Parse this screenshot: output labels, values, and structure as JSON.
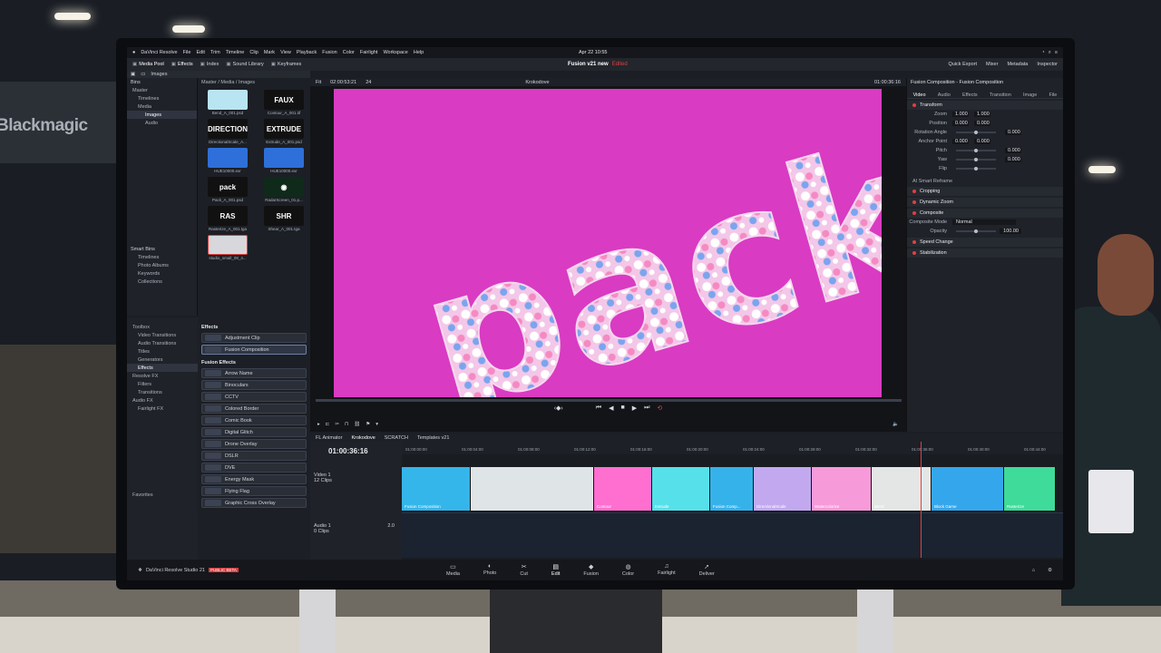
{
  "environment": {
    "booth_sign": "Blackmagic"
  },
  "menubar": {
    "app": "DaVinci Resolve",
    "project_path": "DaVinci Resolve Studio - Fusion v21 new",
    "items": [
      "DaVinci Resolve",
      "File",
      "Edit",
      "Trim",
      "Timeline",
      "Clip",
      "Mark",
      "View",
      "Playback",
      "Fusion",
      "Color",
      "Fairlight",
      "Workspace",
      "Help"
    ],
    "clock": "Apr 22  10:55"
  },
  "toolbar": {
    "left": [
      "Media Pool",
      "Effects",
      "Index",
      "Sound Library",
      "Keyframes"
    ],
    "project_title": "Fusion v21 new",
    "edited": "Edited",
    "right": [
      "Quick Export",
      "Mixer",
      "Metadata",
      "Inspector"
    ]
  },
  "panel_bar": {
    "master_label": "Master / Media / Images",
    "images_label": "Images"
  },
  "bins": {
    "header": "Bins",
    "items": [
      {
        "label": "Master",
        "sel": false
      },
      {
        "label": "Timelines",
        "sel": false
      },
      {
        "label": "Media",
        "sel": false
      },
      {
        "label": "Images",
        "sel": true
      },
      {
        "label": "Audio",
        "sel": false
      }
    ],
    "smart_header": "Smart Bins",
    "smart_items": [
      "Timelines",
      "Photo Albums",
      "Keywords",
      "Collections"
    ]
  },
  "media": {
    "thumbs": [
      {
        "cap": "Bend_A_001.psd",
        "color": "#b9e4f2",
        "txt": ""
      },
      {
        "cap": "Contour_A_001.tif",
        "color": "#111111",
        "txt": "FAUX"
      },
      {
        "cap": "DirectionalScale_A...",
        "color": "#111111",
        "txt": "DIRECTION"
      },
      {
        "cap": "Extrude_A_001.psd",
        "color": "#111111",
        "txt": "EXTRUDE"
      },
      {
        "cap": "HUE10000.exr",
        "color": "#2f6fd9",
        "txt": ""
      },
      {
        "cap": "HUE10000.exr",
        "color": "#2f6fd9",
        "txt": ""
      },
      {
        "cap": "Pack_A_001.psd",
        "color": "#111111",
        "txt": "pack"
      },
      {
        "cap": "RadarScreen_01.p...",
        "color": "#0f2a1a",
        "txt": "◉"
      },
      {
        "cap": "Rasterize_A_001.tga",
        "color": "#111111",
        "txt": "RAS"
      },
      {
        "cap": "Shear_A_001.tga",
        "color": "#111111",
        "txt": "SHR"
      },
      {
        "cap": "studio_small_08_4...",
        "color": "#d8d8dc",
        "txt": ""
      }
    ]
  },
  "effects_tree": {
    "items": [
      "Toolbox",
      "Video Transitions",
      "Audio Transitions",
      "Titles",
      "Generators",
      "Effects",
      "Resolve FX",
      "Filters",
      "Transitions",
      "Audio FX",
      "Fairlight FX"
    ],
    "favorites": "Favorites"
  },
  "effects_list": {
    "group1": "Effects",
    "group1_items": [
      "Adjustment Clip",
      "Fusion Composition"
    ],
    "group2": "Fusion Effects",
    "group2_items": [
      "Arrow Name",
      "Binoculars",
      "CCTV",
      "Colored Border",
      "Comic Book",
      "Digital Glitch",
      "Drone Overlay",
      "DSLR",
      "DVE",
      "Energy Mask",
      "Flying Flag",
      "Graphic Cross Overlay"
    ]
  },
  "viewer": {
    "zoom": "Fit",
    "timecode_left": "02:00:53:21",
    "fps": "24",
    "clip_name": "Krokodove",
    "timecode_right": "01:00:36:16",
    "canvas_color": "#d93bc2",
    "artwork_text": "pack"
  },
  "inspector": {
    "title": "Fusion Composition - Fusion Composition",
    "tabs": [
      "Video",
      "Audio",
      "Effects",
      "Transition",
      "Image",
      "File"
    ],
    "transform": "Transform",
    "rows": [
      {
        "label": "Zoom",
        "x": "1.000",
        "y": "1.000"
      },
      {
        "label": "Position",
        "x": "0.000",
        "y": "0.000"
      },
      {
        "label": "Rotation Angle",
        "x": "",
        "y": "0.000"
      },
      {
        "label": "Anchor Point",
        "x": "0.000",
        "y": "0.000"
      },
      {
        "label": "Pitch",
        "x": "",
        "y": "0.000"
      },
      {
        "label": "Yaw",
        "x": "",
        "y": "0.000"
      },
      {
        "label": "Flip",
        "x": "",
        "y": ""
      }
    ],
    "smart_reframe": "AI Smart Reframe",
    "sections": [
      "Cropping",
      "Dynamic Zoom",
      "Composite"
    ],
    "composite_mode_label": "Composite Mode",
    "composite_mode": "Normal",
    "opacity_label": "Opacity",
    "opacity": "100.00",
    "sections2": [
      "Speed Change",
      "Stabilization"
    ]
  },
  "timeline": {
    "tabs": [
      "FL Animator",
      "Krokodove",
      "SCRATCH",
      "Templates v21"
    ],
    "timecode": "01:00:36:16",
    "ruler": [
      "01:00:00:00",
      "01:00:04:00",
      "01:00:08:00",
      "01:00:12:00",
      "01:00:16:00",
      "01:00:20:00",
      "01:00:24:00",
      "01:00:28:00",
      "01:00:32:00",
      "01:00:36:00",
      "01:00:40:00",
      "01:00:44:00"
    ],
    "video_track": "Video 1",
    "video_clips_count": "12 Clips",
    "audio_track": "Audio 1",
    "audio_clips_count": "0 Clips",
    "audio_level": "2.0",
    "clips": [
      {
        "name": "Fusion Composition",
        "color": "#34b6ea",
        "w": 76
      },
      {
        "name": "",
        "color": "#dfe5e6",
        "w": 136
      },
      {
        "name": "Contour",
        "color": "#ff6fd0",
        "w": 64
      },
      {
        "name": "Extrude",
        "color": "#56e1ea",
        "w": 64
      },
      {
        "name": "Fusion Comp...",
        "color": "#36b2ea",
        "w": 48
      },
      {
        "name": "DirectionalScale",
        "color": "#c2a9ef",
        "w": 64
      },
      {
        "name": "Watercolorize",
        "color": "#f79ad9",
        "w": 66
      },
      {
        "name": "Bend",
        "color": "#e4e6e6",
        "w": 66
      },
      {
        "name": "Block Game",
        "color": "#34a7ec",
        "w": 80
      },
      {
        "name": "Rasterize",
        "color": "#3fdb9a",
        "w": 57
      }
    ]
  },
  "pagebar": {
    "brand": "DaVinci Resolve Studio 21",
    "beta": "PUBLIC BETA",
    "pages": [
      {
        "label": "Media",
        "icon": "▭",
        "act": false
      },
      {
        "label": "Photo",
        "icon": "◐",
        "act": false
      },
      {
        "label": "Cut",
        "icon": "✂",
        "act": false
      },
      {
        "label": "Edit",
        "icon": "▤",
        "act": true
      },
      {
        "label": "Fusion",
        "icon": "◆",
        "act": false
      },
      {
        "label": "Color",
        "icon": "◍",
        "act": false
      },
      {
        "label": "Fairlight",
        "icon": "♫",
        "act": false
      },
      {
        "label": "Deliver",
        "icon": "➚",
        "act": false
      }
    ]
  }
}
